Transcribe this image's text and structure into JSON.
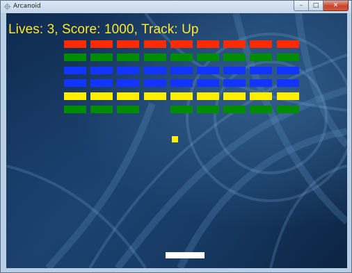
{
  "window": {
    "title": "Arcanoid",
    "app_icon": "app-icon",
    "minimize_glyph": "–",
    "maximize_glyph": "□",
    "close_glyph": "✕"
  },
  "hud": {
    "text": "Lives: 3, Score: 1000, Track: Up",
    "lives": 3,
    "score": 1000,
    "track": "Up",
    "color": "#ffe92a"
  },
  "colors": {
    "red": "#ff2a00",
    "green": "#008c00",
    "blue": "#1234ff",
    "yellow": "#ffee00",
    "paddle": "#ffffff",
    "ball": "#ffee00"
  },
  "bricks": {
    "columns": 9,
    "rows": [
      {
        "color": "red",
        "present": [
          1,
          1,
          1,
          1,
          1,
          1,
          1,
          1,
          1
        ]
      },
      {
        "color": "green",
        "present": [
          1,
          1,
          1,
          1,
          1,
          1,
          1,
          1,
          1
        ]
      },
      {
        "color": "blue",
        "present": [
          1,
          1,
          1,
          1,
          1,
          1,
          1,
          1,
          1
        ]
      },
      {
        "color": "blue",
        "present": [
          1,
          1,
          1,
          1,
          1,
          1,
          1,
          1,
          1
        ]
      },
      {
        "color": "yellow",
        "present": [
          1,
          1,
          1,
          1,
          1,
          1,
          1,
          1,
          1
        ]
      },
      {
        "color": "green",
        "present": [
          1,
          1,
          1,
          0,
          1,
          1,
          1,
          1,
          1
        ]
      }
    ]
  }
}
